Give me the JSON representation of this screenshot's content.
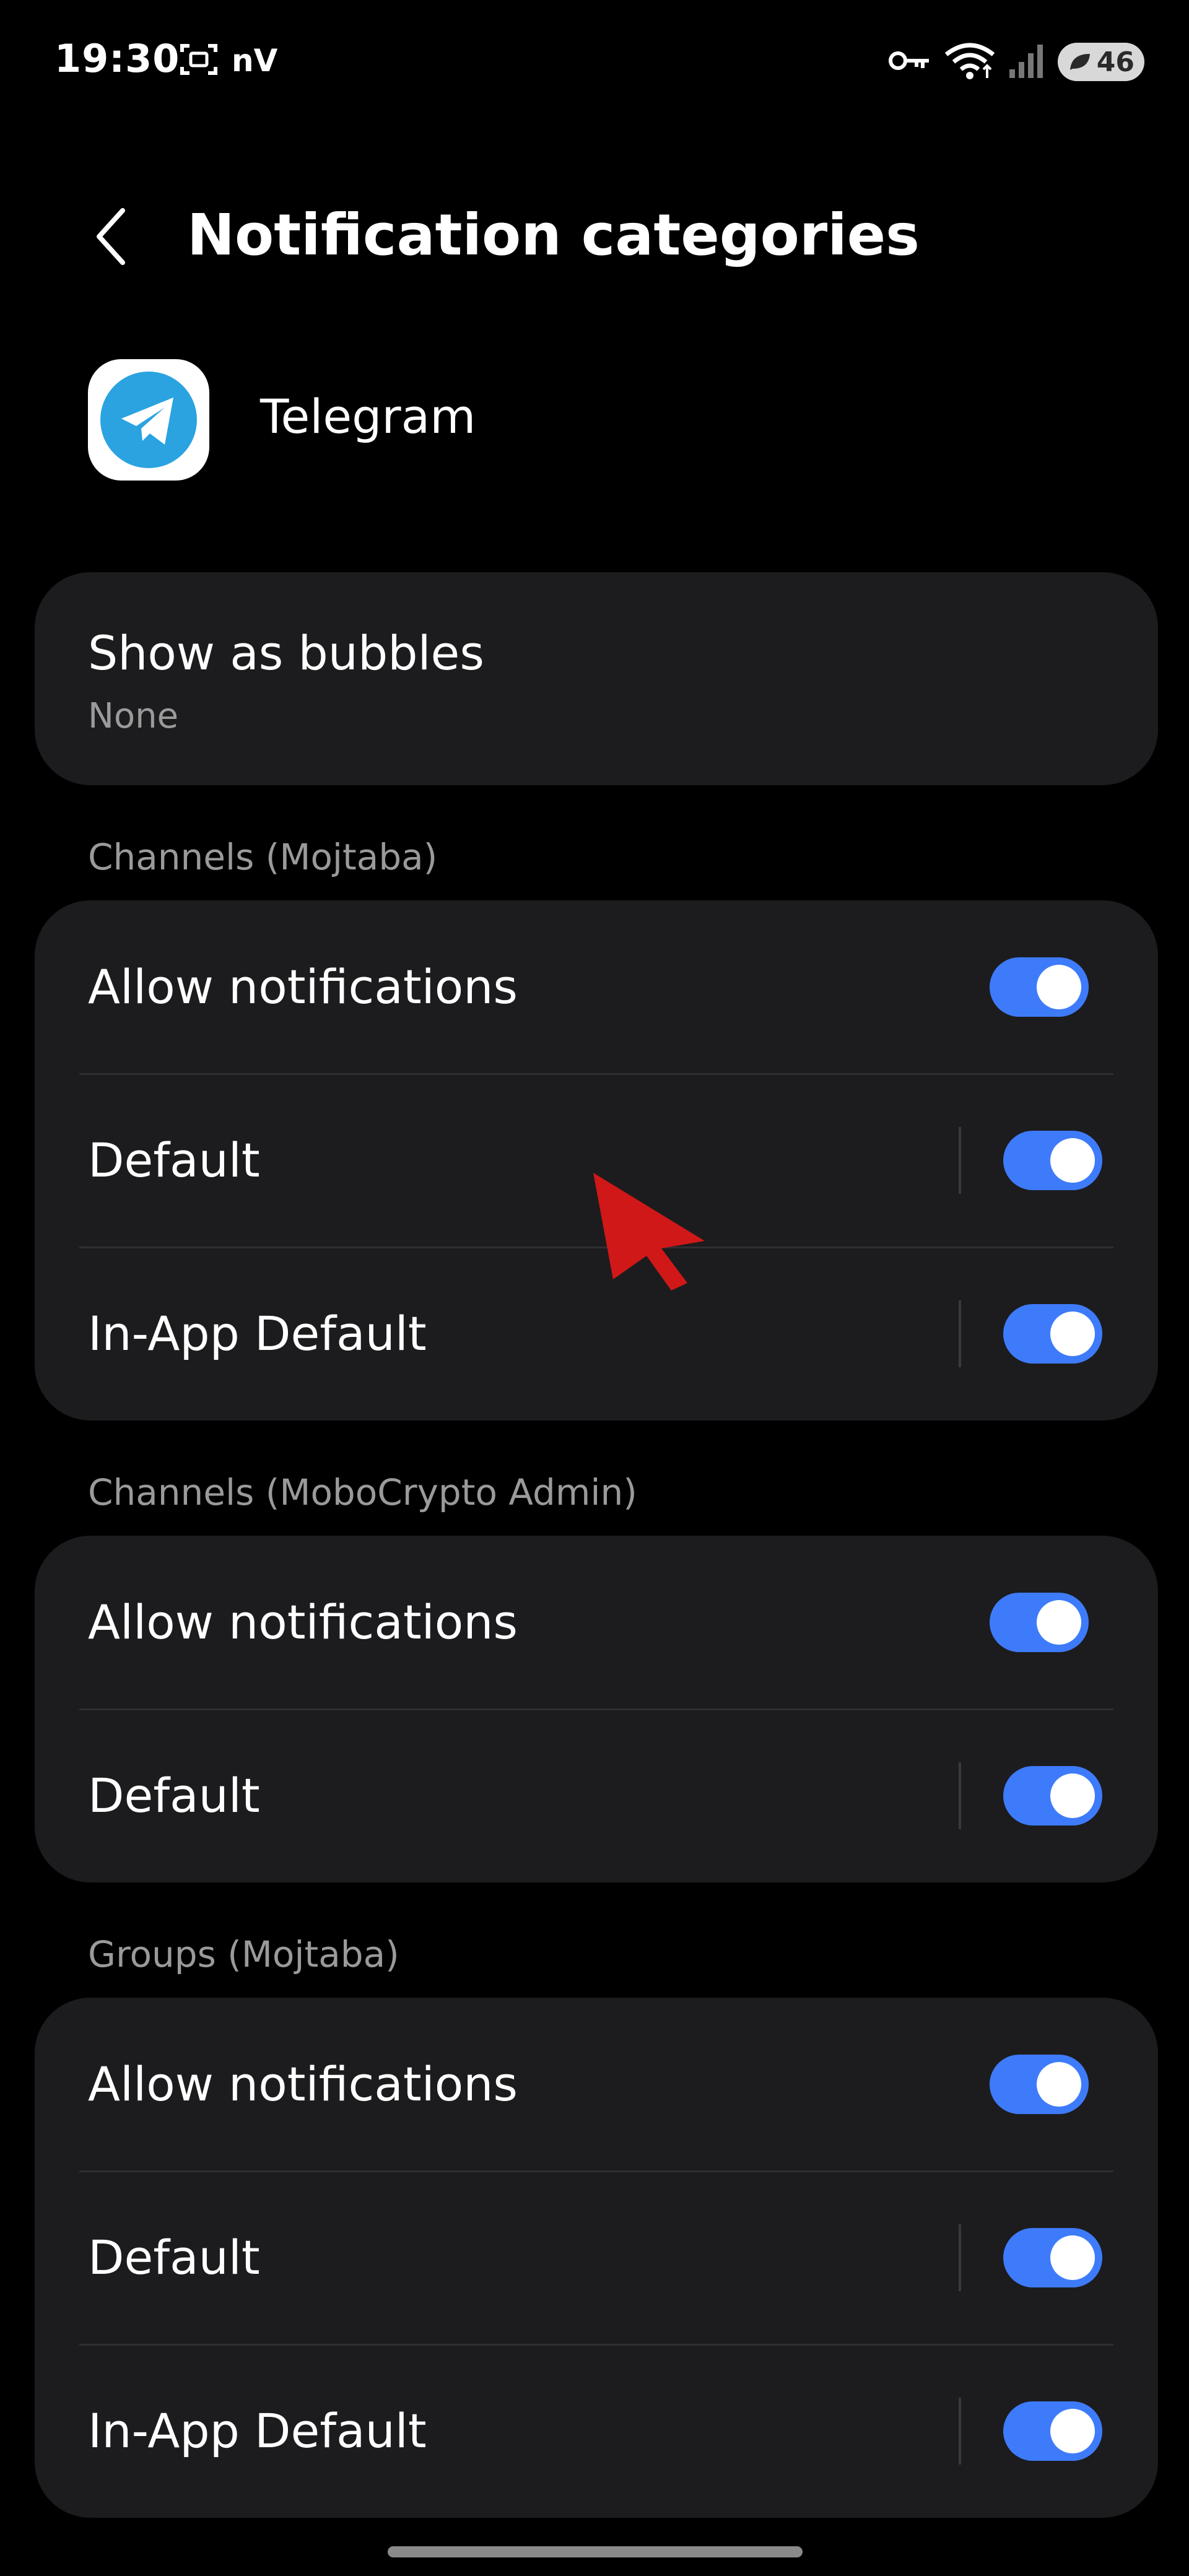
{
  "status_bar": {
    "time": "19:30",
    "carrier_glyph": "nV",
    "battery": "46",
    "icons": [
      "screenshot-icon",
      "key-icon",
      "wifi-icon",
      "signal-icon",
      "battery-icon"
    ]
  },
  "header": {
    "title": "Notification categories",
    "back_icon": "chevron-left-icon"
  },
  "app": {
    "name": "Telegram",
    "icon": "telegram-icon",
    "icon_color": "#2aa3e0"
  },
  "bubbles": {
    "title": "Show as bubbles",
    "value": "None"
  },
  "sections": [
    {
      "header": "Channels (Mojtaba)",
      "rows": [
        {
          "label": "Allow notifications",
          "on": true
        },
        {
          "label": "Default",
          "on": true
        },
        {
          "label": "In-App Default",
          "on": true
        }
      ]
    },
    {
      "header": "Channels (MoboCrypto Admin)",
      "rows": [
        {
          "label": "Allow notifications",
          "on": true
        },
        {
          "label": "Default",
          "on": true
        }
      ]
    },
    {
      "header": "Groups (Mojtaba)",
      "rows": [
        {
          "label": "Allow notifications",
          "on": true
        },
        {
          "label": "Default",
          "on": true
        },
        {
          "label": "In-App Default",
          "on": true
        }
      ]
    }
  ],
  "colors": {
    "background": "#000000",
    "card": "#1c1c1e",
    "accent": "#3e7bfa",
    "secondary_text": "#9a9a9a",
    "cursor": "#d01818"
  }
}
